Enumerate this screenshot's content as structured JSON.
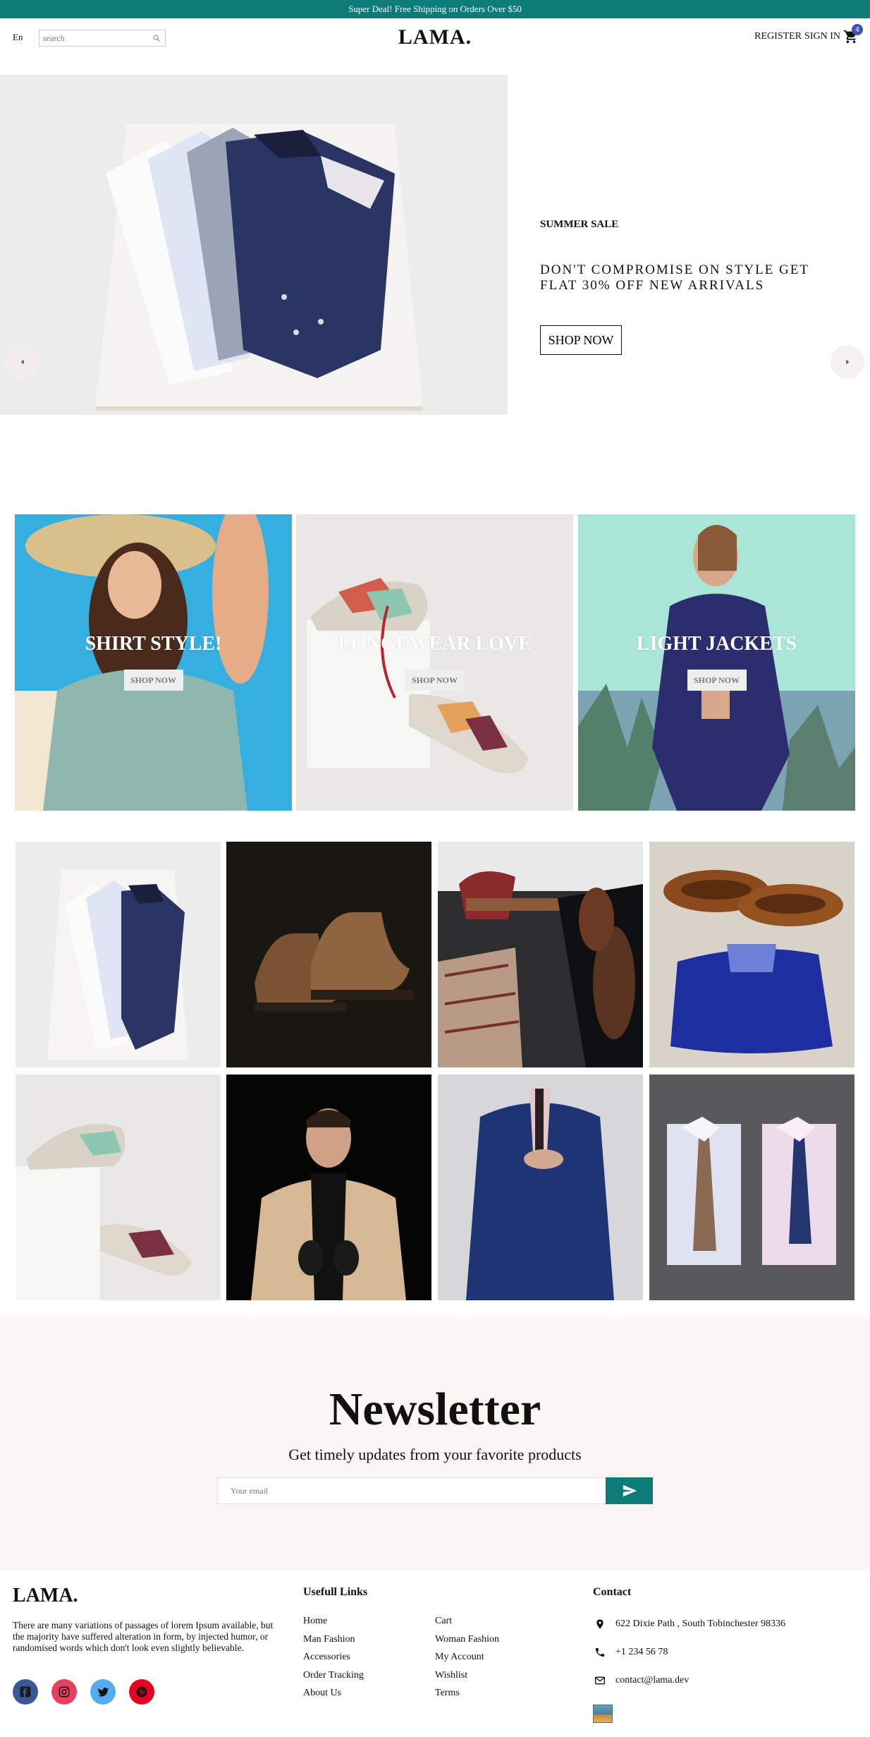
{
  "announcement": {
    "text": "Super Deal! Free Shipping on Orders Over $50"
  },
  "navbar": {
    "language": "En",
    "search_placeholder": "search",
    "logo": "LAMA.",
    "register_label": "REGISTER",
    "signin_label": "SIGN IN",
    "cart_count": "4"
  },
  "slider": {
    "tag": "SUMMER SALE",
    "description": "DON'T COMPROMISE ON STYLE GET FLAT 30% OFF NEW ARRIVALS",
    "button_label": "SHOP NOW"
  },
  "categories": [
    {
      "title": "SHIRT STYLE!",
      "button_label": "SHOP NOW"
    },
    {
      "title": "LONGEWEAR LOVE",
      "button_label": "SHOP NOW"
    },
    {
      "title": "LIGHT JACKETS",
      "button_label": "SHOP NOW"
    }
  ],
  "newsletter": {
    "title": "Newsletter",
    "subtitle": "Get timely updates from your favorite products",
    "email_placeholder": "Your email"
  },
  "footer": {
    "logo": "LAMA.",
    "description": "There are many variations of passages of lorem Ipsum available, but the majority have suffered alteration in form, by injected humor, or randomised words which don't look even slightly believable.",
    "links_title": "Usefull Links",
    "links_col1": [
      "Home",
      "Man Fashion",
      "Accessories",
      "Order Tracking",
      "About Us"
    ],
    "links_col2": [
      "Cart",
      "Woman Fashion",
      "My Account",
      "Wishlist",
      "Terms"
    ],
    "contact_title": "Contact",
    "address": "622 Dixie Path , South Tobinchester 98336",
    "phone": "+1 234 56 78",
    "email": "contact@lama.dev"
  },
  "colors": {
    "accent": "#0c7c78",
    "badge": "#3f51b5",
    "newsletter_bg": "#fbf5f3",
    "facebook": "#3b5999",
    "instagram": "#e4405f",
    "twitter": "#55acee",
    "pinterest": "#e60023"
  }
}
